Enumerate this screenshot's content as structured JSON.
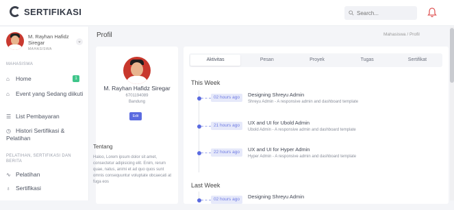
{
  "header": {
    "brand": "SERTIFIKASI",
    "search_placeholder": "Search...",
    "notification_icon": "bell-icon"
  },
  "sidebar": {
    "user": {
      "name": "M. Rayhan Hafidz Siregar",
      "role": "MAHASISWA"
    },
    "section_main": "MAHASISWA",
    "items": [
      {
        "label": "Home",
        "icon": "home-icon",
        "badge": "1"
      },
      {
        "label": "Event yang Sedang diikuti",
        "icon": "home-icon"
      },
      {
        "label": "List Pembayaran",
        "icon": "list-icon"
      },
      {
        "label": "Histori Sertifikasi & Pelatihan",
        "icon": "history-icon"
      }
    ],
    "section_secondary": "PELATIHAN, SERTIFIKASI DAN BERITA",
    "items2": [
      {
        "label": "Pelatihan",
        "icon": "activity-icon"
      },
      {
        "label": "Sertifikasi",
        "icon": "award-icon"
      }
    ]
  },
  "page": {
    "title": "Profil",
    "breadcrumb": {
      "parent": "Mahasiswa",
      "separator": "/",
      "current": "Profil"
    }
  },
  "profile": {
    "name": "M. Rayhan Hafidz Siregar",
    "id": "6701194089",
    "city": "Bandung",
    "edit_label": "Edit",
    "about_title": "Tentang",
    "about_text": "Haloo, Lorem ipsum dolor sit amet, consectetur adipisicing elit. Enim, rerum quae, natus, animi et ad quo quos sunt omnis consequuntur voluptate obcaecati at fuga eos"
  },
  "tabs": [
    "Aktivitas",
    "Pesan",
    "Proyek",
    "Tugas",
    "Sertifikat"
  ],
  "timeline": {
    "this_week_title": "This Week",
    "this_week": [
      {
        "time": "02 hours ago",
        "title": "Designing Shreyu Admin",
        "subtitle": "Shreyu Admin - A responsive admin and dashboard template"
      },
      {
        "time": "21 hours ago",
        "title": "UX and UI for Ubold Admin",
        "subtitle": "Ubold Admin - A responsive admin and dashboard template"
      },
      {
        "time": "22 hours ago",
        "title": "UX and UI for Hyper Admin",
        "subtitle": "Hyper Admin - A responsive admin and dashboard template"
      }
    ],
    "last_week_title": "Last Week",
    "last_week": [
      {
        "time": "02 hours ago",
        "title": "Designing Shreyu Admin",
        "subtitle": ""
      }
    ]
  },
  "colors": {
    "accent": "#5b6be0",
    "badge": "#3fc58a",
    "avatar_bg": "#c8372c"
  }
}
